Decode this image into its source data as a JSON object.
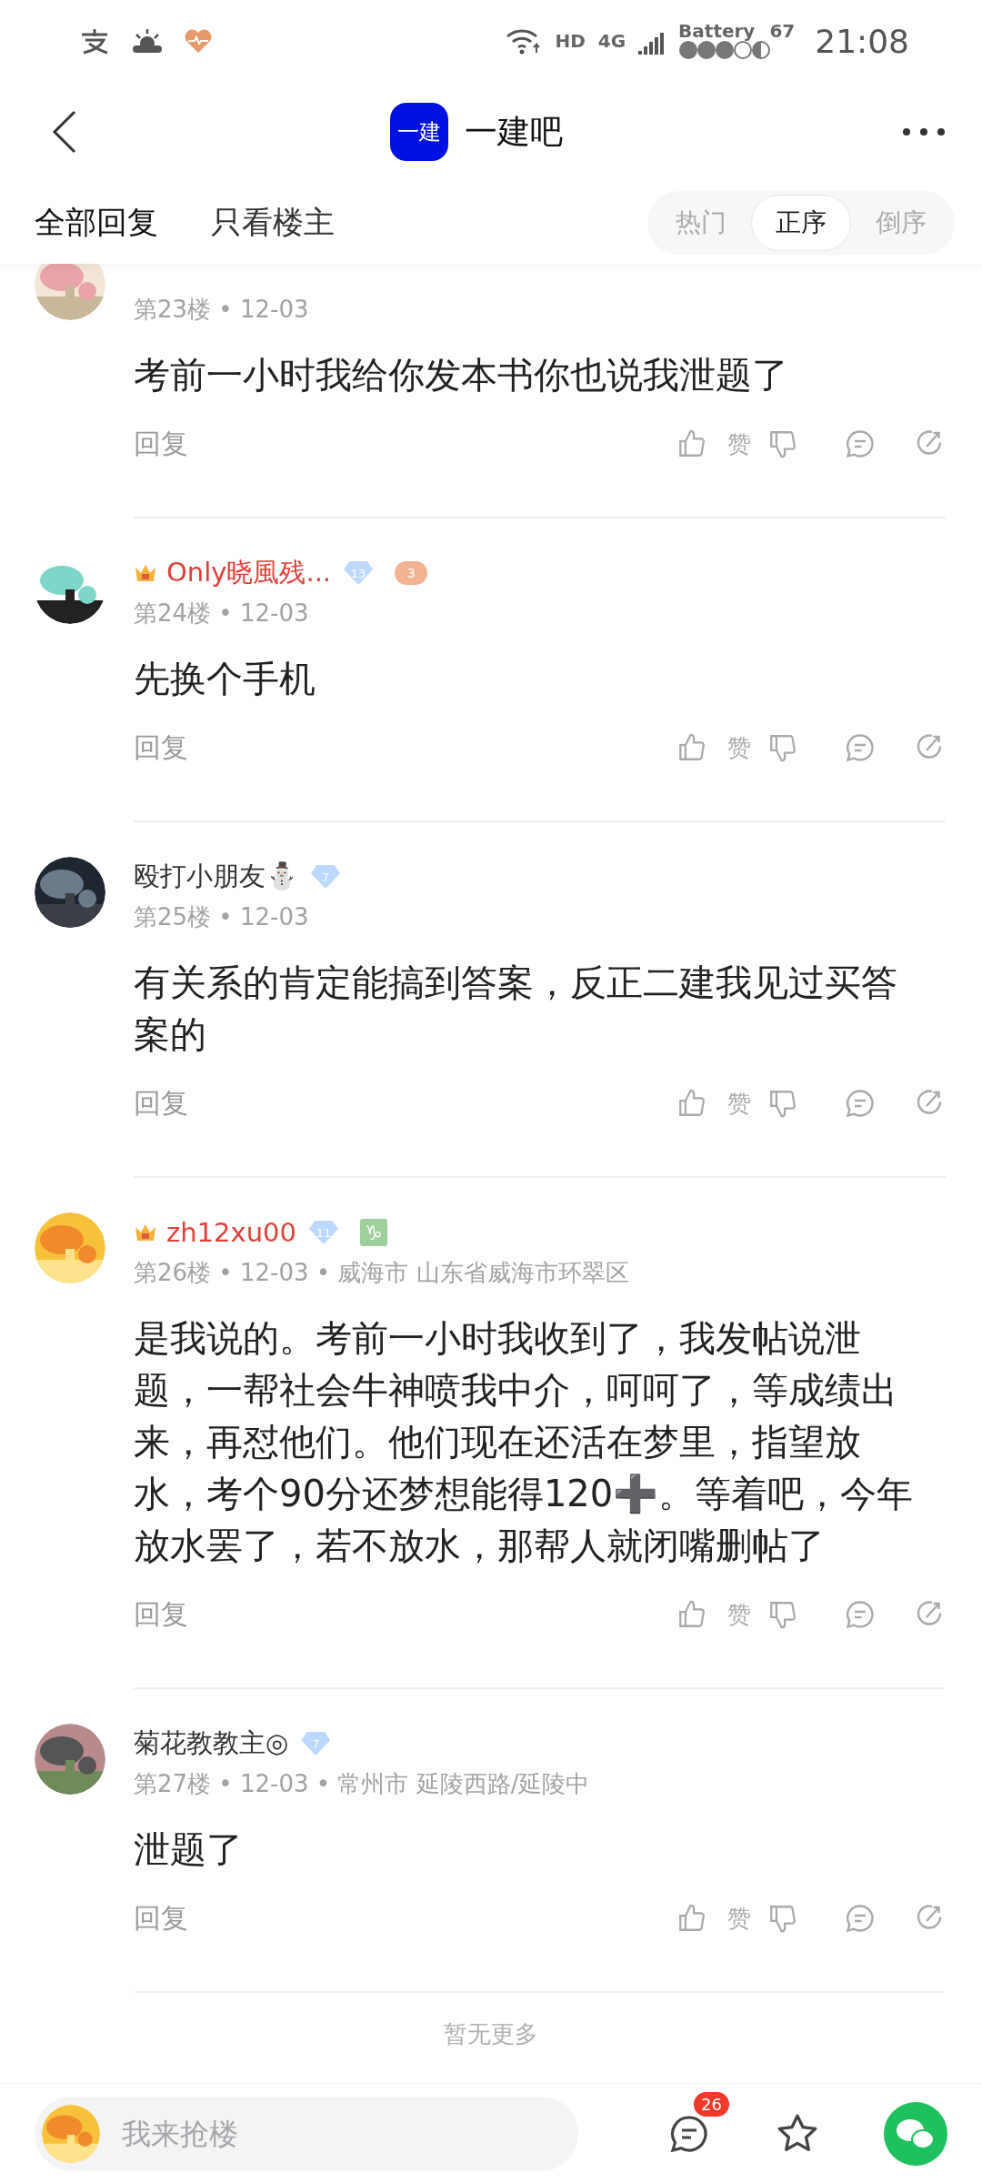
{
  "status_bar": {
    "network": "HD",
    "cell": "4G",
    "battery_label": "Battery",
    "battery_value": "67",
    "time": "21:08"
  },
  "header": {
    "logo": "一建",
    "title": "一建吧"
  },
  "tabs": [
    {
      "label": "全部回复",
      "selected": true
    },
    {
      "label": "只看楼主",
      "selected": false
    }
  ],
  "sort": [
    {
      "label": "热门",
      "selected": false
    },
    {
      "label": "正序",
      "selected": true
    },
    {
      "label": "倒序",
      "selected": false
    }
  ],
  "comments": [
    {
      "meta": "第23楼 • 12-03",
      "body": "考前一小时我给你发本书你也说我泄题了",
      "reply": "回复",
      "like": "赞",
      "vip": false
    },
    {
      "name": "Only晓風残...",
      "meta": "第24楼 • 12-03",
      "body": "先换个手机",
      "reply": "回复",
      "like": "赞",
      "vip": true,
      "badges": [
        {
          "kind": "level",
          "text": "13"
        },
        {
          "kind": "game",
          "text": "3"
        }
      ]
    },
    {
      "name": "殴打小朋友⛄",
      "meta": "第25楼 • 12-03",
      "body": "有关系的肯定能搞到答案，反正二建我见过买答案的",
      "reply": "回复",
      "like": "赞",
      "vip": false,
      "badges": [
        {
          "kind": "level",
          "text": "7"
        }
      ]
    },
    {
      "name": "zh12xu00",
      "meta": "第26楼 • 12-03 • 威海市 山东省威海市环翠区",
      "body": "是我说的。考前一小时我收到了，我发帖说泄题，一帮社会牛神喷我中介，呵呵了，等成绩出来，再怼他们。他们现在还活在梦里，指望放水，考个90分还梦想能得120➕。等着吧，今年放水罢了，若不放水，那帮人就闭嘴删帖了",
      "reply": "回复",
      "like": "赞",
      "vip": true,
      "badges": [
        {
          "kind": "level",
          "text": "11"
        },
        {
          "kind": "zodiac",
          "text": "♑"
        }
      ]
    },
    {
      "name": "菊花教教主◎",
      "meta": "第27楼 • 12-03 • 常州市 延陵西路/延陵中",
      "body": "泄题了",
      "reply": "回复",
      "like": "赞",
      "vip": false,
      "badges": [
        {
          "kind": "level",
          "text": "7"
        }
      ]
    }
  ],
  "end_note": "暂无更多",
  "bottom_bar": {
    "placeholder": "我来抢楼",
    "comment_count": "26"
  }
}
